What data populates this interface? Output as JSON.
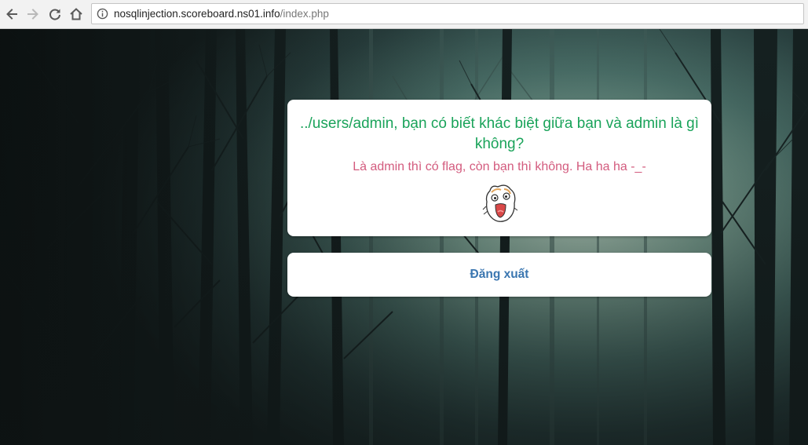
{
  "browser": {
    "url_host": "nosqlinjection.scoreboard.ns01.info",
    "url_path": "/index.php"
  },
  "icons": {
    "back": "back-arrow-icon",
    "forward": "forward-arrow-icon",
    "reload": "reload-icon",
    "home": "home-icon",
    "info": "info-icon"
  },
  "message": {
    "question": "../users/admin, bạn có biết khác biệt giữa bạn và admin là gì không?",
    "answer": "Là admin thì có flag, còn bạn thì không. Ha ha ha -_-",
    "sticker": "laughing-sticker-icon"
  },
  "logout": {
    "label": "Đăng xuất"
  },
  "colors": {
    "question": "#1aa35a",
    "answer": "#d35b7e",
    "link": "#3a76b0"
  }
}
